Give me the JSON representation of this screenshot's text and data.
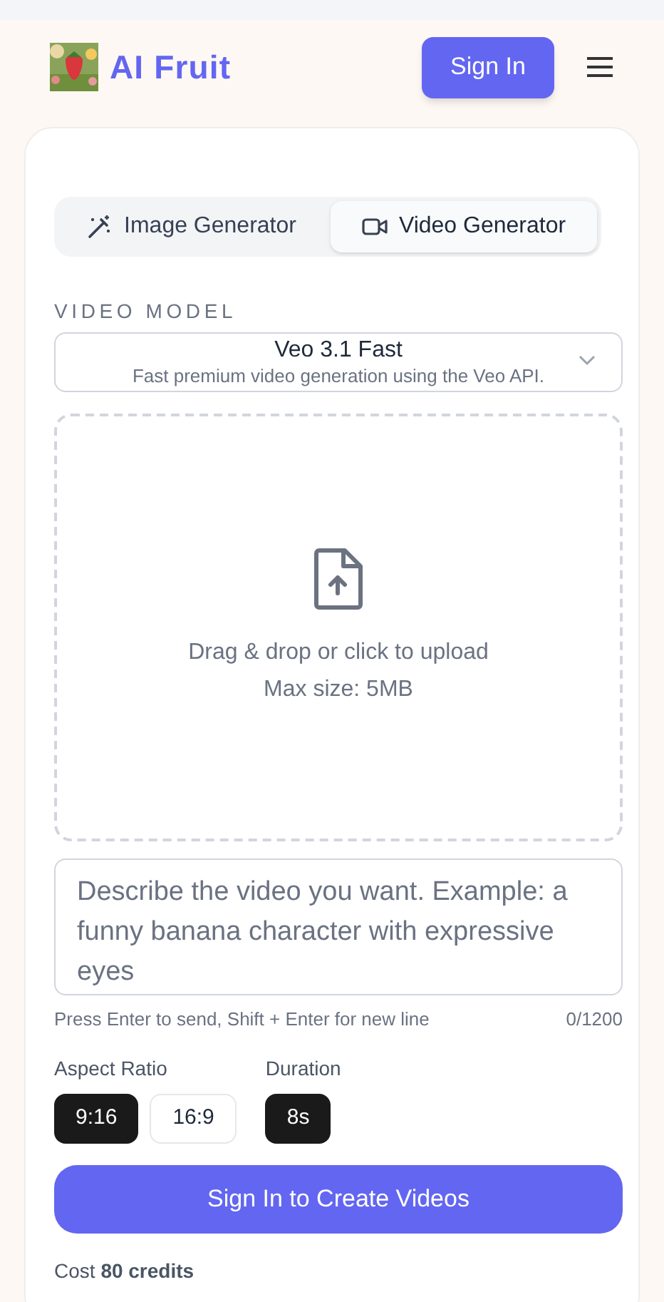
{
  "header": {
    "brand": "AI Fruit",
    "sign_in": "Sign In"
  },
  "tabs": [
    {
      "label": "Image Generator",
      "selected": false
    },
    {
      "label": "Video Generator",
      "selected": true
    }
  ],
  "model": {
    "label": "VIDEO MODEL",
    "name": "Veo 3.1 Fast",
    "description": "Fast premium video generation using the Veo API."
  },
  "upload": {
    "text": "Drag & drop or click to upload",
    "limit": "Max size: 5MB"
  },
  "prompt": {
    "placeholder": "Describe the video you want. Example: a funny banana character with expressive eyes",
    "hint": "Press Enter to send, Shift + Enter for new line",
    "count": "0/1200"
  },
  "aspect_ratio": {
    "label": "Aspect Ratio",
    "options": [
      {
        "label": "9:16",
        "selected": true
      },
      {
        "label": "16:9",
        "selected": false
      }
    ]
  },
  "duration": {
    "label": "Duration",
    "options": [
      {
        "label": "8s",
        "selected": true
      }
    ]
  },
  "submit": "Sign In to Create Videos",
  "cost": "Cost **80 credits**"
}
